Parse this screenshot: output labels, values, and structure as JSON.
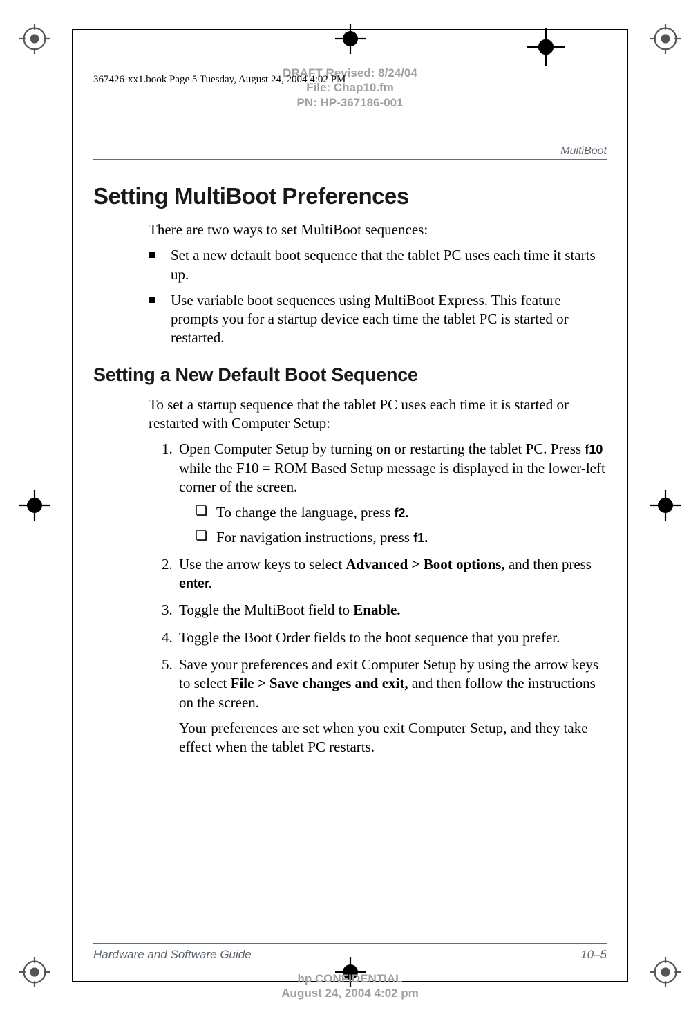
{
  "book_info": "367426-xx1.book  Page 5  Tuesday, August 24, 2004  4:02 PM",
  "draft": {
    "line1": "DRAFT Revised: 8/24/04",
    "line2": "File: Chap10.fm",
    "line3": "PN: HP-367186-001"
  },
  "running_head": "MultiBoot",
  "h1": "Setting MultiBoot Preferences",
  "intro_para": "There are two ways to set MultiBoot sequences:",
  "bullets": [
    "Set a new default boot sequence that the tablet PC uses each time it starts up.",
    "Use variable boot sequences using MultiBoot Express. This feature prompts you for a startup device each time the tablet PC is started or restarted."
  ],
  "h2": "Setting a New Default Boot Sequence",
  "para2": "To set a startup sequence that the tablet PC uses each time it is started or restarted with Computer Setup:",
  "steps": {
    "s1_pre": "Open Computer Setup by turning on or restarting the tablet PC. Press ",
    "s1_key": "f10",
    "s1_post": " while the F10 = ROM Based Setup message is displayed in the lower-left corner of the screen.",
    "s1_sub1_pre": "To change the language, press ",
    "s1_sub1_key": "f2.",
    "s1_sub2_pre": "For navigation instructions, press ",
    "s1_sub2_key": "f1.",
    "s2_pre": "Use the arrow keys to select ",
    "s2_bold": "Advanced > Boot options,",
    "s2_mid": " and then press ",
    "s2_key": "enter.",
    "s3_pre": "Toggle the MultiBoot field to ",
    "s3_bold": "Enable.",
    "s4": "Toggle the Boot Order fields to the boot sequence that you prefer.",
    "s5_pre": "Save your preferences and exit Computer Setup by using the arrow keys to select ",
    "s5_bold": "File > Save changes and exit,",
    "s5_post": " and then follow the instructions on the screen.",
    "s5_note": "Your preferences are set when you exit Computer Setup, and they take effect when the tablet PC restarts."
  },
  "footer": {
    "left": "Hardware and Software Guide",
    "right": "10–5"
  },
  "confidential": {
    "line1": "hp CONFIDENTIAL",
    "line2": "August 24, 2004 4:02 pm"
  }
}
